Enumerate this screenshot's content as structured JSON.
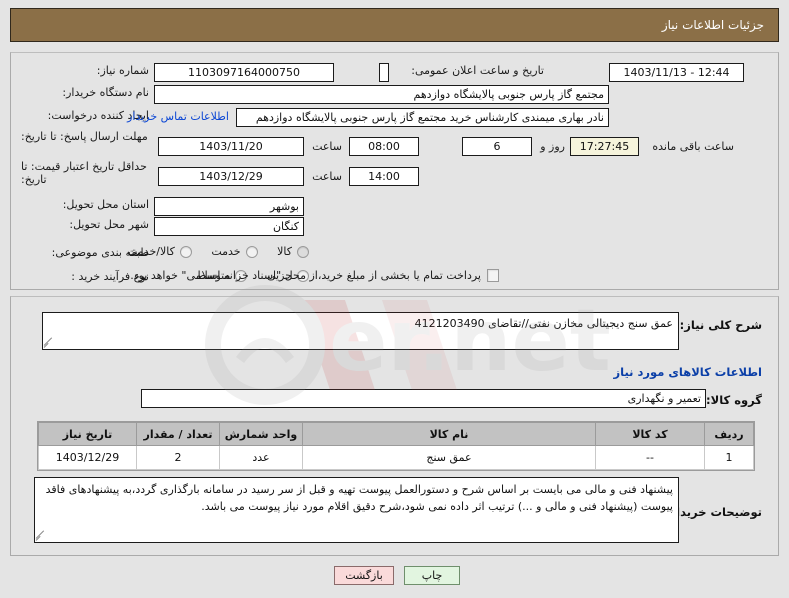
{
  "header": {
    "title": "جزئیات اطلاعات نیاز"
  },
  "form": {
    "need_number_label": "شماره نیاز:",
    "need_number_value": "1103097164000750",
    "announce_label": "تاریخ و ساعت اعلان عمومی:",
    "announce_value": "12:44 - 1403/11/13",
    "buyer_org_label": "نام دستگاه خریدار:",
    "buyer_org_value": "مجتمع گاز پارس جنوبی  پالایشگاه دوازدهم",
    "creator_label": "ایجاد کننده درخواست:",
    "creator_value": "نادر بهاری میمندی کارشناس خرید مجتمع گاز پارس جنوبی  پالایشگاه دوازدهم",
    "contact_link": "اطلاعات تماس خریدار",
    "response_deadline_label": "مهلت ارسال پاسخ: تا تاریخ:",
    "response_deadline_date": "1403/11/20",
    "response_deadline_hour_label": "ساعت",
    "response_deadline_hour": "08:00",
    "days_value": "6",
    "days_unit_label": "روز و",
    "countdown_value": "17:27:45",
    "remaining_label": "ساعت باقی مانده",
    "price_validity_label": "حداقل تاریخ اعتبار قیمت: تا تاریخ:",
    "price_validity_date": "1403/12/29",
    "price_validity_hour_label": "ساعت",
    "price_validity_hour": "14:00",
    "province_label": "استان محل تحویل:",
    "province_value": "بوشهر",
    "city_label": "شهر محل تحویل:",
    "city_value": "کنگان",
    "classification_label": "طبقه بندی موضوعی:",
    "classification_options": [
      "کالا",
      "خدمت",
      "کالا/خدمت"
    ],
    "process_label": "نوع فرآیند خرید :",
    "process_options": [
      "جزیی",
      "متوسط"
    ],
    "treasury_note": "پرداخت تمام یا بخشی از مبلغ خرید،از محل \"اسناد خزانه اسلامی\" خواهد بود."
  },
  "description": {
    "label": "شرح کلی نیاز:",
    "value": "عمق سنج دیجیتالی مخازن نفتی//تقاضای 4121203490"
  },
  "goods": {
    "section_heading": "اطلاعات کالاهای مورد نیاز",
    "group_label": "گروه کالا:",
    "group_value": "تعمیر و نگهداری",
    "table": {
      "headers": [
        "ردیف",
        "کد کالا",
        "نام کالا",
        "واحد شمارش",
        "تعداد / مقدار",
        "تاریخ نیاز"
      ],
      "rows": [
        {
          "row_no": "1",
          "code": "--",
          "name": "عمق سنج",
          "unit": "عدد",
          "quantity": "2",
          "need_date": "1403/12/29"
        }
      ]
    }
  },
  "buyer_notes": {
    "label": "توضیحات خریدار:",
    "value": "پیشنهاد فنی و مالی می بایست بر اساس شرح و دستورالعمل پیوست تهیه و قبل از سر رسید در سامانه بارگذاری گردد،به پیشنهادهای فاقد پیوست (پیشنهاد فنی و مالی و ...) ترتیب اثر داده نمی شود،شرح دقیق اقلام مورد نیاز پیوست می باشد."
  },
  "footer": {
    "print_label": "چاپ",
    "back_label": "بازگشت"
  },
  "watermark": {
    "text": "Artatender.net"
  },
  "colors": {
    "header_bg": "#8b6f47",
    "page_bg": "#e4e4e4",
    "link": "#0b46d4",
    "section_heading": "#0b3fa8",
    "table_header_bg": "#c2c2c2",
    "print_btn_bg": "#e2f5e0",
    "back_btn_bg": "#fadada",
    "countdown_bg": "#f6f4dc"
  }
}
